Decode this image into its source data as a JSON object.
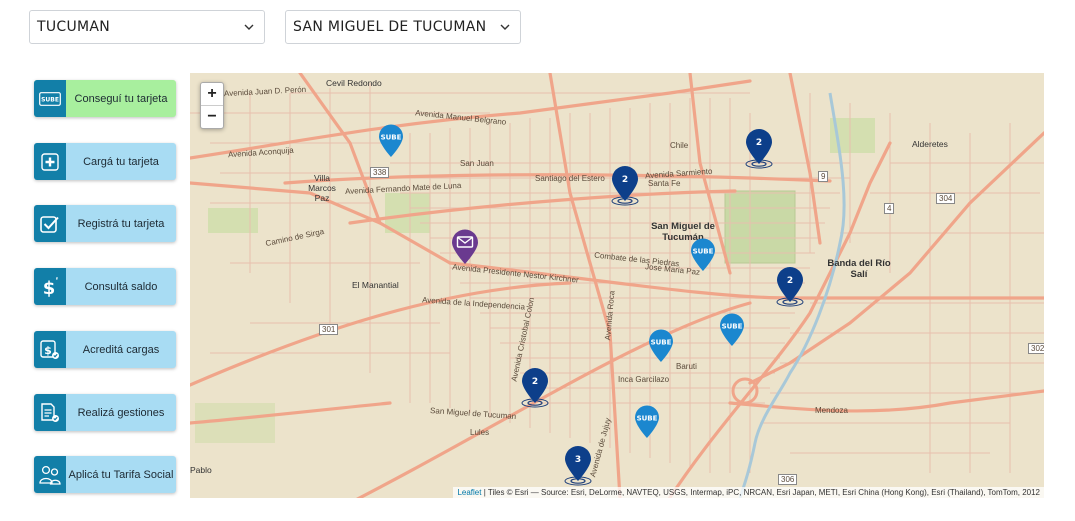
{
  "filters": {
    "province": "TUCUMAN",
    "city": "SAN MIGUEL DE TUCUMAN"
  },
  "menu": [
    {
      "label": "Conseguí tu tarjeta",
      "icon": "sube-card-icon",
      "active": true
    },
    {
      "label": "Cargá tu tarjeta",
      "icon": "plus-card-icon",
      "active": false
    },
    {
      "label": "Registrá tu tarjeta",
      "icon": "checkbox-icon",
      "active": false
    },
    {
      "label": "Consultá saldo",
      "icon": "dollar-icon",
      "active": false
    },
    {
      "label": "Acreditá cargas",
      "icon": "dollar-check-icon",
      "active": false
    },
    {
      "label": "Realizá gestiones",
      "icon": "document-check-icon",
      "active": false
    },
    {
      "label": "Aplicá tu Tarifa Social",
      "icon": "people-icon",
      "active": false
    }
  ],
  "map": {
    "zoom_in": "+",
    "zoom_out": "−",
    "attribution_link": "Leaflet",
    "attribution_text": " | Tiles © Esri — Source: Esri, DeLorme, NAVTEQ, USGS, Intermap, iPC, NRCAN, Esri Japan, METI, Esri China (Hong Kong), Esri (Thailand), TomTom, 2012",
    "sube_label": "SUBE",
    "clusters": [
      "2",
      "2",
      "2",
      "2",
      "3"
    ],
    "places": {
      "cevil_redondo": "Cevil Redondo",
      "villa_marcos_paz": "Villa Marcos Paz",
      "el_manantial": "El Manantial",
      "san_miguel": "San Miguel de Tucumán",
      "banda_del_rio_sali": "Banda del Río Salí",
      "alderetes": "Alderetes",
      "pablo": "Pablo"
    },
    "streets": {
      "belgrano": "Avenida Manuel Belgrano",
      "fernando_de_luna": "Avenida Fernando Mate de Luna",
      "nestor_kirchner": "Avenida Presidente Nestor Kirchner",
      "aconquija": "Avenida Aconquija",
      "sarmiento": "Avenida Sarmiento",
      "san_juan": "San Juan",
      "santiago": "Santiago del Estero",
      "santa_fe": "Santa Fe",
      "chile": "Chile",
      "sirga": "Camino de Sirga",
      "independencia": "Avenida de la Independencia",
      "colon": "Avenida Cristobal Colon",
      "roca": "Avenida Roca",
      "mendoza": "Mendoza",
      "san_miguel_road": "San Miguel de Tucuman",
      "lules": "Lules",
      "peron": "Avenida Juan D. Perón",
      "jujuy": "Avenida de Jujuy",
      "garcilazo": "Inca Garcilazo",
      "baruti": "Baruti",
      "combate": "Combate de las Piedras",
      "jose_maria_paz": "Jose Maria Paz",
      "n_301": "301",
      "n_338": "338",
      "n_9": "9",
      "n_306": "306",
      "n_302": "302",
      "n_304": "304",
      "n_4": "4"
    }
  }
}
